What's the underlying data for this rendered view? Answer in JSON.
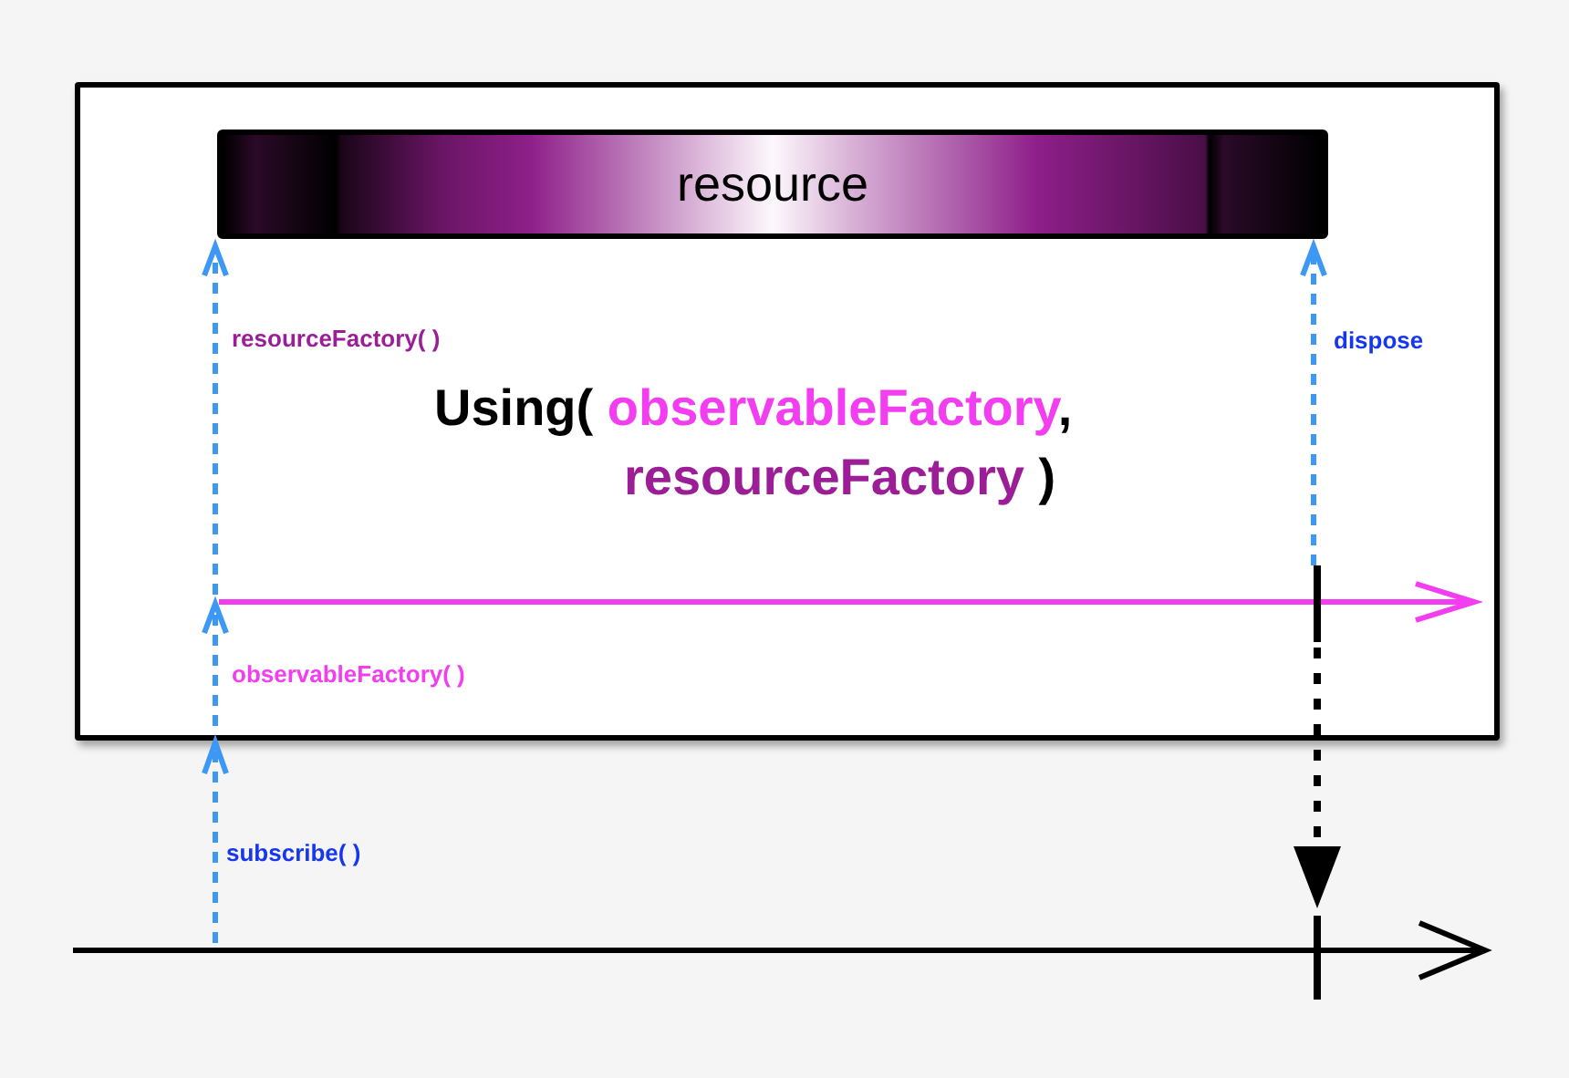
{
  "operator": {
    "resource": {
      "label": "resource"
    },
    "title_lines": [
      {
        "parts": [
          {
            "text": "Using( ",
            "kind": "plain"
          },
          {
            "text": "observableFactory",
            "kind": "observable"
          },
          {
            "text": ",",
            "kind": "plain"
          }
        ]
      },
      {
        "parts": [
          {
            "text": "resourceFactory",
            "kind": "resource"
          },
          {
            "text": " )",
            "kind": "plain"
          }
        ]
      }
    ]
  },
  "labels": [
    {
      "text": "resourceFactory( )",
      "kind": "resource"
    },
    {
      "text": "dispose",
      "kind": "dispose"
    },
    {
      "text": "observableFactory( )",
      "kind": "observable"
    },
    {
      "text": "subscribe( )",
      "kind": "subscribe"
    }
  ]
}
